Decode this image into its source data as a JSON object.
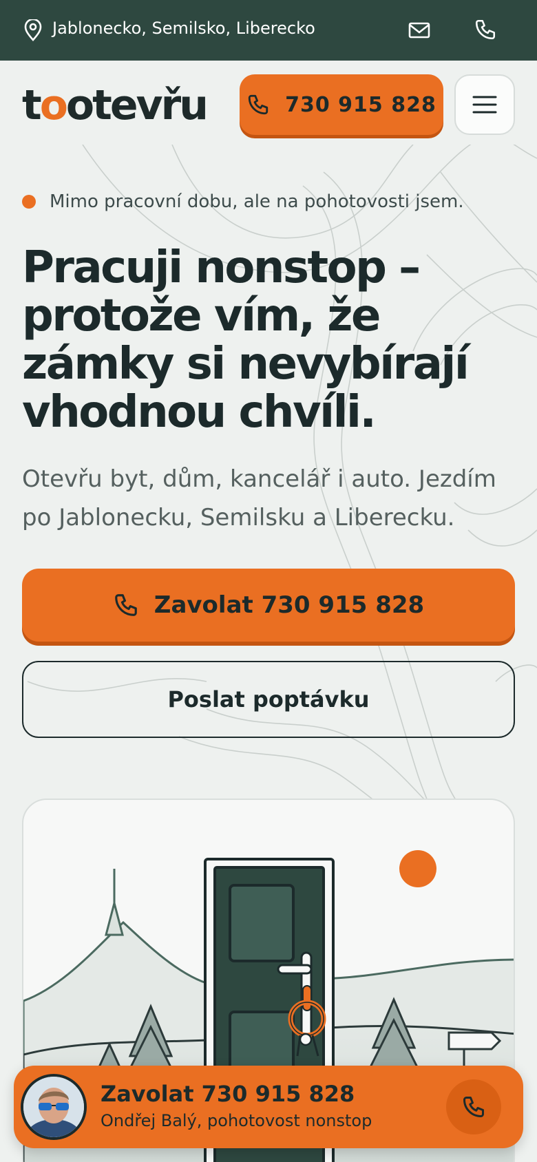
{
  "topbar": {
    "region": "Jablonecko, Semilsko, Liberecko",
    "icons": [
      "map-pin-icon",
      "mail-icon",
      "phone-icon"
    ]
  },
  "header": {
    "logo": "tootevřu",
    "call_label": "730 915 828",
    "menu_icon": "hamburger-menu-icon"
  },
  "hero": {
    "status": "Mimo pracovní dobu, ale na pohotovosti jsem.",
    "title": "Pracuji nonstop – protože vím, že zámky si nevybírají vhodnou chvíli.",
    "subtitle": "Otevřu byt, dům, kancelář i auto. Jezdím po Jablonecku, Semilsku a Liberecku.",
    "call_button": "Zavolat 730 915 828",
    "inquiry_button": "Poslat poptávku"
  },
  "sticky_bar": {
    "title": "Zavolat 730 915 828",
    "subtitle": "Ondřej Balý, pohotovost nonstop"
  },
  "colors": {
    "accent": "#ea6f22",
    "topbar": "#2e4840",
    "text": "#1c2a2b",
    "background": "#eef1ef"
  }
}
